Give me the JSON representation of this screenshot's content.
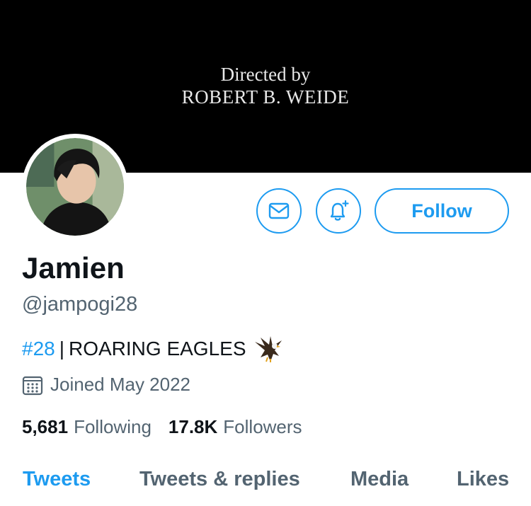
{
  "banner": {
    "line1": "Directed by",
    "line2": "ROBERT B. WEIDE"
  },
  "actions": {
    "message_icon": "envelope-icon",
    "notify_icon": "bell-plus-icon",
    "follow_label": "Follow"
  },
  "profile": {
    "display_name": "Jamien",
    "handle": "@jampogi28",
    "bio_hashtag": "#28",
    "bio_separator": "|",
    "bio_text": "ROARING EAGLES",
    "bio_emoji": "eagle-emoji",
    "joined": "Joined May 2022"
  },
  "stats": {
    "following_count": "5,681",
    "following_label": "Following",
    "followers_count": "17.8K",
    "followers_label": "Followers"
  },
  "tabs": [
    {
      "label": "Tweets",
      "active": true
    },
    {
      "label": "Tweets & replies",
      "active": false
    },
    {
      "label": "Media",
      "active": false
    },
    {
      "label": "Likes",
      "active": false
    }
  ],
  "colors": {
    "accent": "#1d9bf0",
    "text_primary": "#0f1419",
    "text_secondary": "#536471",
    "banner_bg": "#000000"
  }
}
